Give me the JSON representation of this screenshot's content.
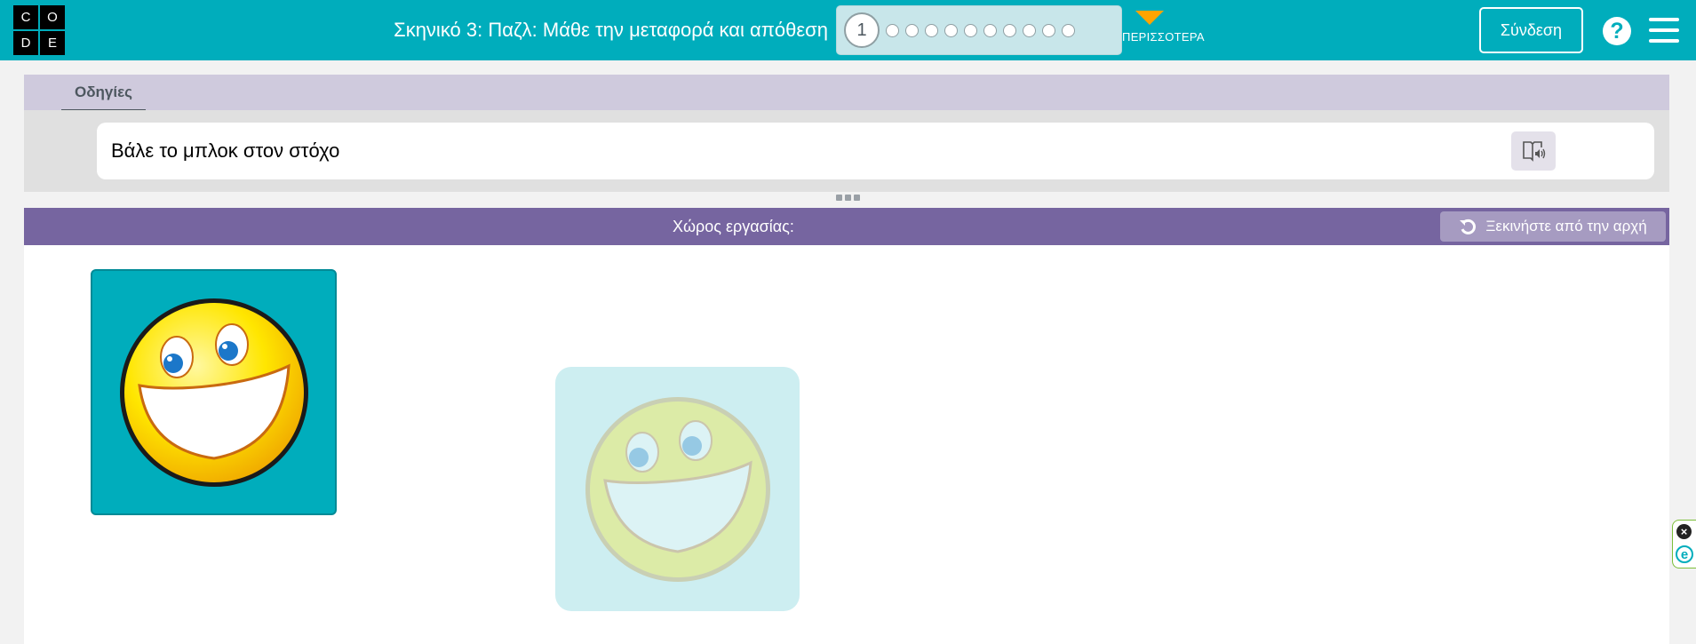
{
  "header": {
    "logo_letters": [
      "C",
      "O",
      "D",
      "E"
    ],
    "stage_title": "Σκηνικό 3: Παζλ: Μάθε την μεταφορά και απόθεση",
    "progress": {
      "current_level": "1",
      "total_levels": 11
    },
    "more_label": "ΠΕΡΙΣΣΟΤΕΡΑ",
    "signin_label": "Σύνδεση",
    "help_glyph": "?",
    "icons": {
      "more": "caret-down-icon",
      "help": "help-icon",
      "menu": "hamburger-icon"
    },
    "colors": {
      "bar": "#00adbc",
      "more_caret": "#ffa400"
    }
  },
  "instructions": {
    "tab_label": "Οδηγίες",
    "text": "Βάλε το μπλοκ στον στόχο",
    "tts_icon": "text-to-speech-icon"
  },
  "workspace": {
    "title": "Χώρος εργασίας:",
    "restart_label": "Ξεκινήστε από την αρχή",
    "restart_icon": "restart-icon",
    "block_image": "smiley-face-icon",
    "target_image": "smiley-face-target-icon",
    "colors": {
      "header": "#7665a0",
      "block": "#00adbc",
      "target": "#cdeef1"
    }
  },
  "side_widget": {
    "close_glyph": "×",
    "e_glyph": "e"
  }
}
